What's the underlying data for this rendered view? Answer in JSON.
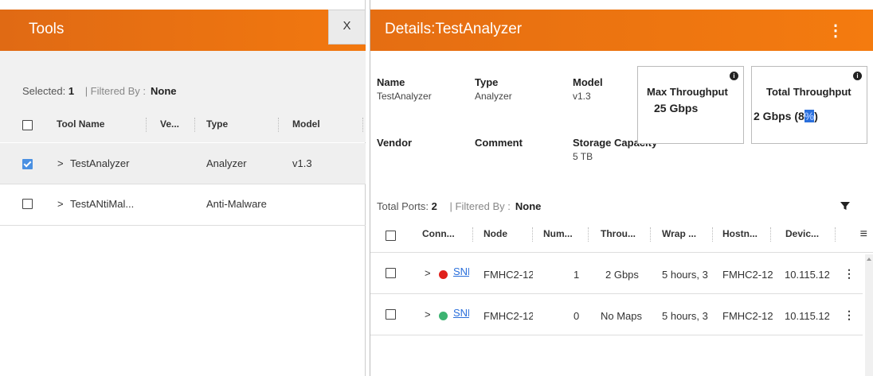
{
  "tools": {
    "title": "Tools",
    "close_label": "X",
    "selected_label": "Selected:",
    "selected_count": "1",
    "filtered_label": "| Filtered By :",
    "filtered_value": "None",
    "columns": [
      "Tool Name",
      "Ve...",
      "Type",
      "Model"
    ],
    "rows": [
      {
        "name": "TestAnalyzer",
        "type": "Analyzer",
        "model": "v1.3",
        "checked": true
      },
      {
        "name": "TestANtiMal...",
        "type": "Anti-Malware",
        "model": "",
        "checked": false
      }
    ]
  },
  "details": {
    "title_prefix": "Details:",
    "title_name": "TestAnalyzer",
    "kebab": "⋮",
    "fields": {
      "name_label": "Name",
      "name_value": "TestAnalyzer",
      "type_label": "Type",
      "type_value": "Analyzer",
      "model_label": "Model",
      "model_value": "v1.3",
      "vendor_label": "Vendor",
      "comment_label": "Comment",
      "storage_label": "Storage Capacity",
      "storage_value": "5 TB"
    },
    "max_throughput": {
      "label": "Max Throughput",
      "value": "25 Gbps"
    },
    "total_throughput": {
      "label": "Total Throughput",
      "value_prefix": "2 Gbps (8",
      "value_highlight": "%",
      "value_suffix": ")"
    },
    "ports": {
      "total_label": "Total Ports:",
      "total_count": "2",
      "filtered_label": "| Filtered By :",
      "filtered_value": "None",
      "columns": [
        "Conn...",
        "Node",
        "Num...",
        "Throu...",
        "Wrap ...",
        "Hostn...",
        "Devic..."
      ],
      "rows": [
        {
          "conn": "SNF",
          "status_color": "#e0201b",
          "node": "FMHC2-12",
          "num": "1",
          "throughput": "2 Gbps",
          "wrap": "5 hours, 3",
          "host": "FMHC2-12",
          "device": "10.115.12"
        },
        {
          "conn": "SNF",
          "status_color": "#3cb371",
          "node": "FMHC2-12",
          "num": "0",
          "throughput": "No Maps",
          "wrap": "5 hours, 3",
          "host": "FMHC2-12",
          "device": "10.115.12"
        }
      ]
    }
  }
}
